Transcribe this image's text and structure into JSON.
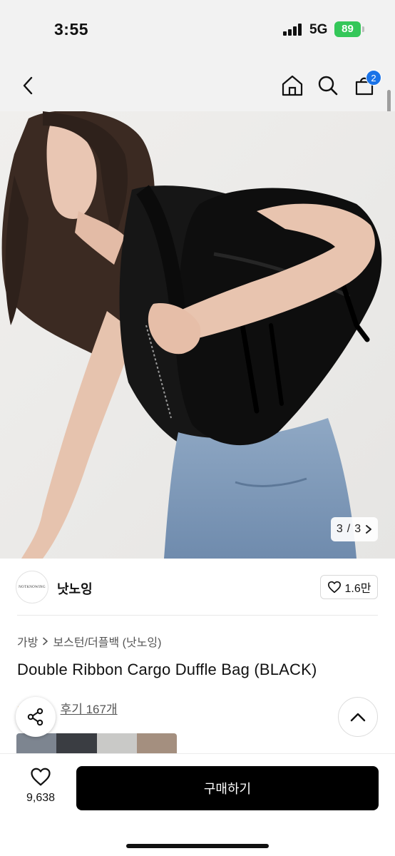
{
  "status_bar": {
    "time": "3:55",
    "network": "5G",
    "battery": "89"
  },
  "nav": {
    "cart_count": "2"
  },
  "hero": {
    "page_current": "3",
    "page_separator": "/",
    "page_total": "3"
  },
  "brand": {
    "logo_text": "NOTKNOWING",
    "name": "낫노잉",
    "likes": "1.6만"
  },
  "product": {
    "breadcrumb": [
      "가방",
      "보스턴/더플백 (낫노잉)"
    ],
    "title": "Double Ribbon Cargo Duffle Bag (BLACK)",
    "review_label": "후기 167개"
  },
  "bottom": {
    "wish_count": "9,638",
    "buy_label": "구매하기"
  },
  "colors": {
    "badge": "#1a73e8",
    "battery": "#34c759",
    "buy_button": "#000000"
  },
  "icons": [
    "back-icon",
    "home-icon",
    "search-icon",
    "cart-icon",
    "heart-icon",
    "share-icon",
    "chevron-up-icon",
    "chevron-right-icon"
  ]
}
